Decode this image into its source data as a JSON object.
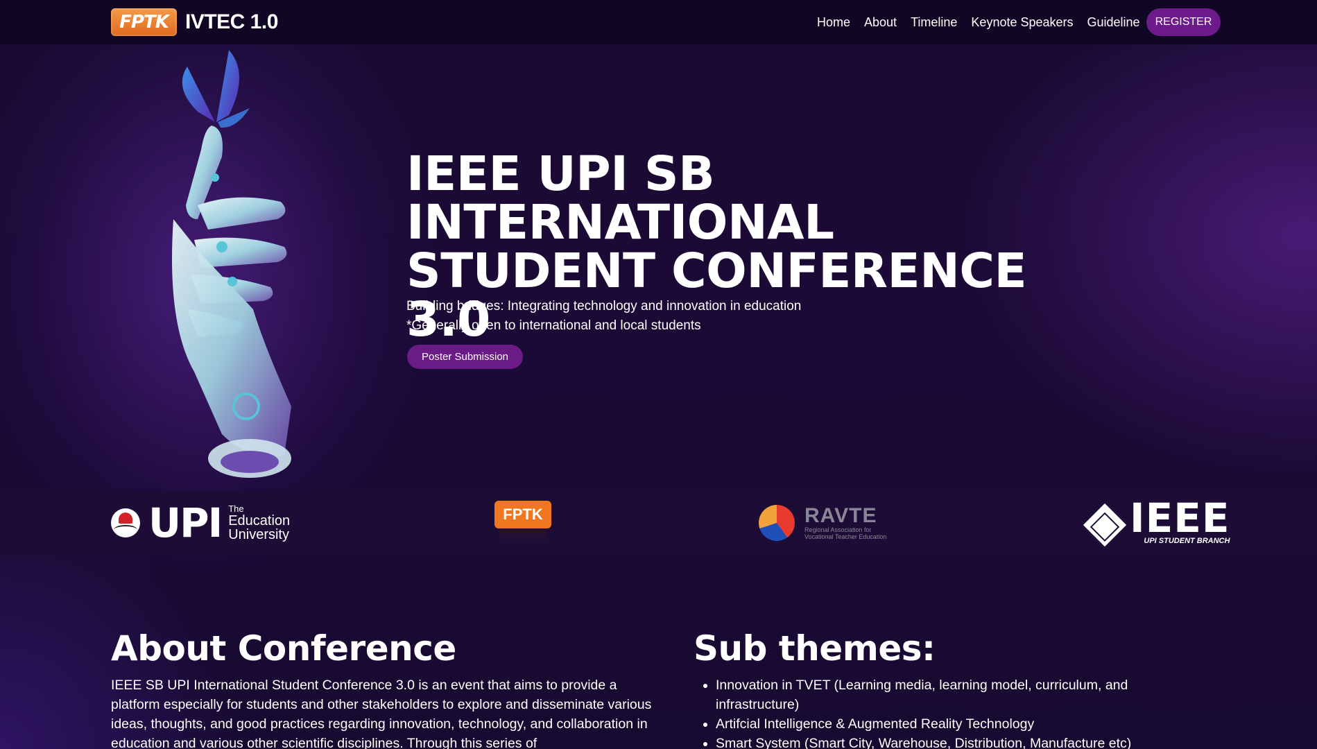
{
  "nav": {
    "logo_text": "FPTK",
    "brand": "IVTEC 1.0",
    "links": [
      "Home",
      "About",
      "Timeline",
      "Keynote Speakers",
      "Guideline"
    ],
    "register": "REGISTER"
  },
  "hero": {
    "title_lines": [
      "IEEE UPI SB",
      "INTERNATIONAL",
      "STUDENT CONFERENCE 3.0"
    ],
    "subtitle": "Building bridges: Integrating technology and innovation in education",
    "note": "*Generally open to international and local students",
    "button": "Poster Submission"
  },
  "partners": {
    "upi": {
      "wordmark": "UPI",
      "tag_small": "The",
      "tag_line1": "Education",
      "tag_line2": "University"
    },
    "fptk": {
      "wordmark": "FPTK"
    },
    "ravte": {
      "wordmark": "RAVTE",
      "tag_line1": "Regional Association for",
      "tag_line2": "Vocational Teacher Education"
    },
    "ieee": {
      "wordmark": "IEEE",
      "tag": "UPI STUDENT BRANCH"
    }
  },
  "about": {
    "title": "About Conference",
    "text": "IEEE SB UPI International Student Conference 3.0 is an event that aims to provide a platform especially for students and other stakeholders to explore and disseminate various ideas, thoughts, and good practices regarding innovation, technology, and collaboration in education and various other scientific disciplines. Through this series of"
  },
  "themes": {
    "title": "Sub themes:",
    "items": [
      "Innovation in TVET (Learning media, learning model, curriculum, and infrastructure)",
      "Artifcial Intelligence & Augmented Reality Technology",
      "Smart System (Smart City, Warehouse, Distribution, Manufacture etc)"
    ]
  },
  "colors": {
    "background": "#1a0b34",
    "navbar": "#100725",
    "accent": "#6d1a8a",
    "fptk_orange": "#f0761f"
  }
}
